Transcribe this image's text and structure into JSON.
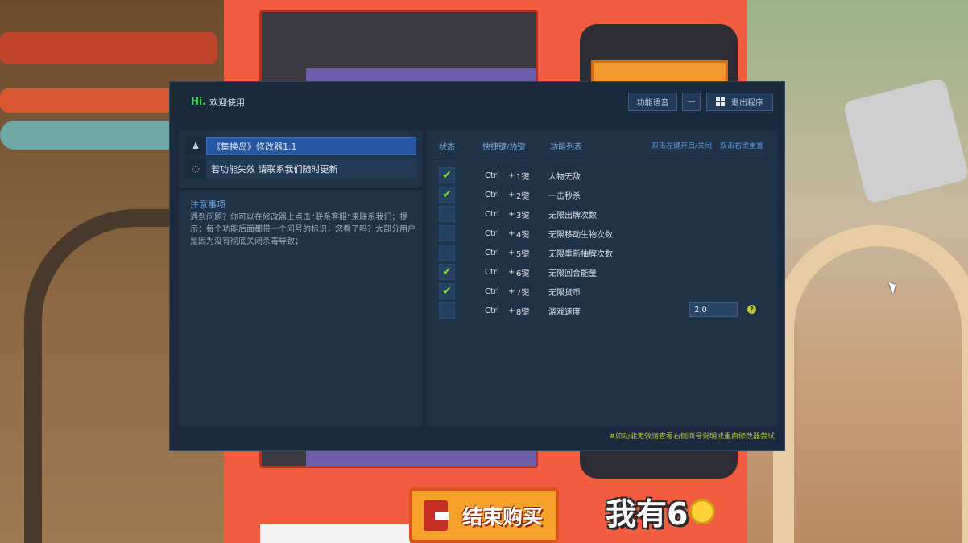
{
  "background": {
    "end_button_label": "结束购买",
    "coins_label": "我有6"
  },
  "trainer": {
    "hi": "Hi.",
    "welcome": "欢迎使用",
    "buttons": {
      "voice": "功能语音",
      "minimize": "—",
      "exit": "退出程序"
    },
    "game_name": "《集换岛》修改器1.1",
    "hint": "若功能失效  请联系我们随时更新",
    "notes_title": "注意事项",
    "notes_body": "遇到问题？你可以在修改器上点击“联系客服”来联系我们；提示：每个功能后面都带一个问号的标识，您看了吗？大部分用户是因为没有彻底关闭杀毒导致；",
    "table_headers": {
      "status": "状态",
      "hotkey": "快捷键/热键",
      "features": "功能列表",
      "dbl_left": "双击左键开启/关闭",
      "dbl_right": "双击右键重置"
    },
    "features": [
      {
        "checked": true,
        "ctrl": "Ctrl",
        "plus": "+",
        "key": "1键",
        "name": "人物无敌"
      },
      {
        "checked": true,
        "ctrl": "Ctrl",
        "plus": "+",
        "key": "2键",
        "name": "一击秒杀"
      },
      {
        "checked": false,
        "ctrl": "Ctrl",
        "plus": "+",
        "key": "3键",
        "name": "无限出牌次数"
      },
      {
        "checked": false,
        "ctrl": "Ctrl",
        "plus": "+",
        "key": "4键",
        "name": "无限移动生物次数"
      },
      {
        "checked": false,
        "ctrl": "Ctrl",
        "plus": "+",
        "key": "5键",
        "name": "无限重新抽牌次数"
      },
      {
        "checked": true,
        "ctrl": "Ctrl",
        "plus": "+",
        "key": "6键",
        "name": "无限回合能量"
      },
      {
        "checked": true,
        "ctrl": "Ctrl",
        "plus": "+",
        "key": "7键",
        "name": "无限货币"
      },
      {
        "checked": false,
        "ctrl": "Ctrl",
        "plus": "+",
        "key": "8键",
        "name": "游戏速度"
      }
    ],
    "speed_value": "2.0",
    "help_mark": "?",
    "check_mark": "✔",
    "footer_note": "#如功能无效请查看右侧问号说明或重启修改器尝试"
  },
  "colors": {
    "accent_green": "#3fd64a",
    "check_green": "#7dd83b",
    "panel_bg": "#1f3248",
    "selected_blue": "#2857a2"
  }
}
